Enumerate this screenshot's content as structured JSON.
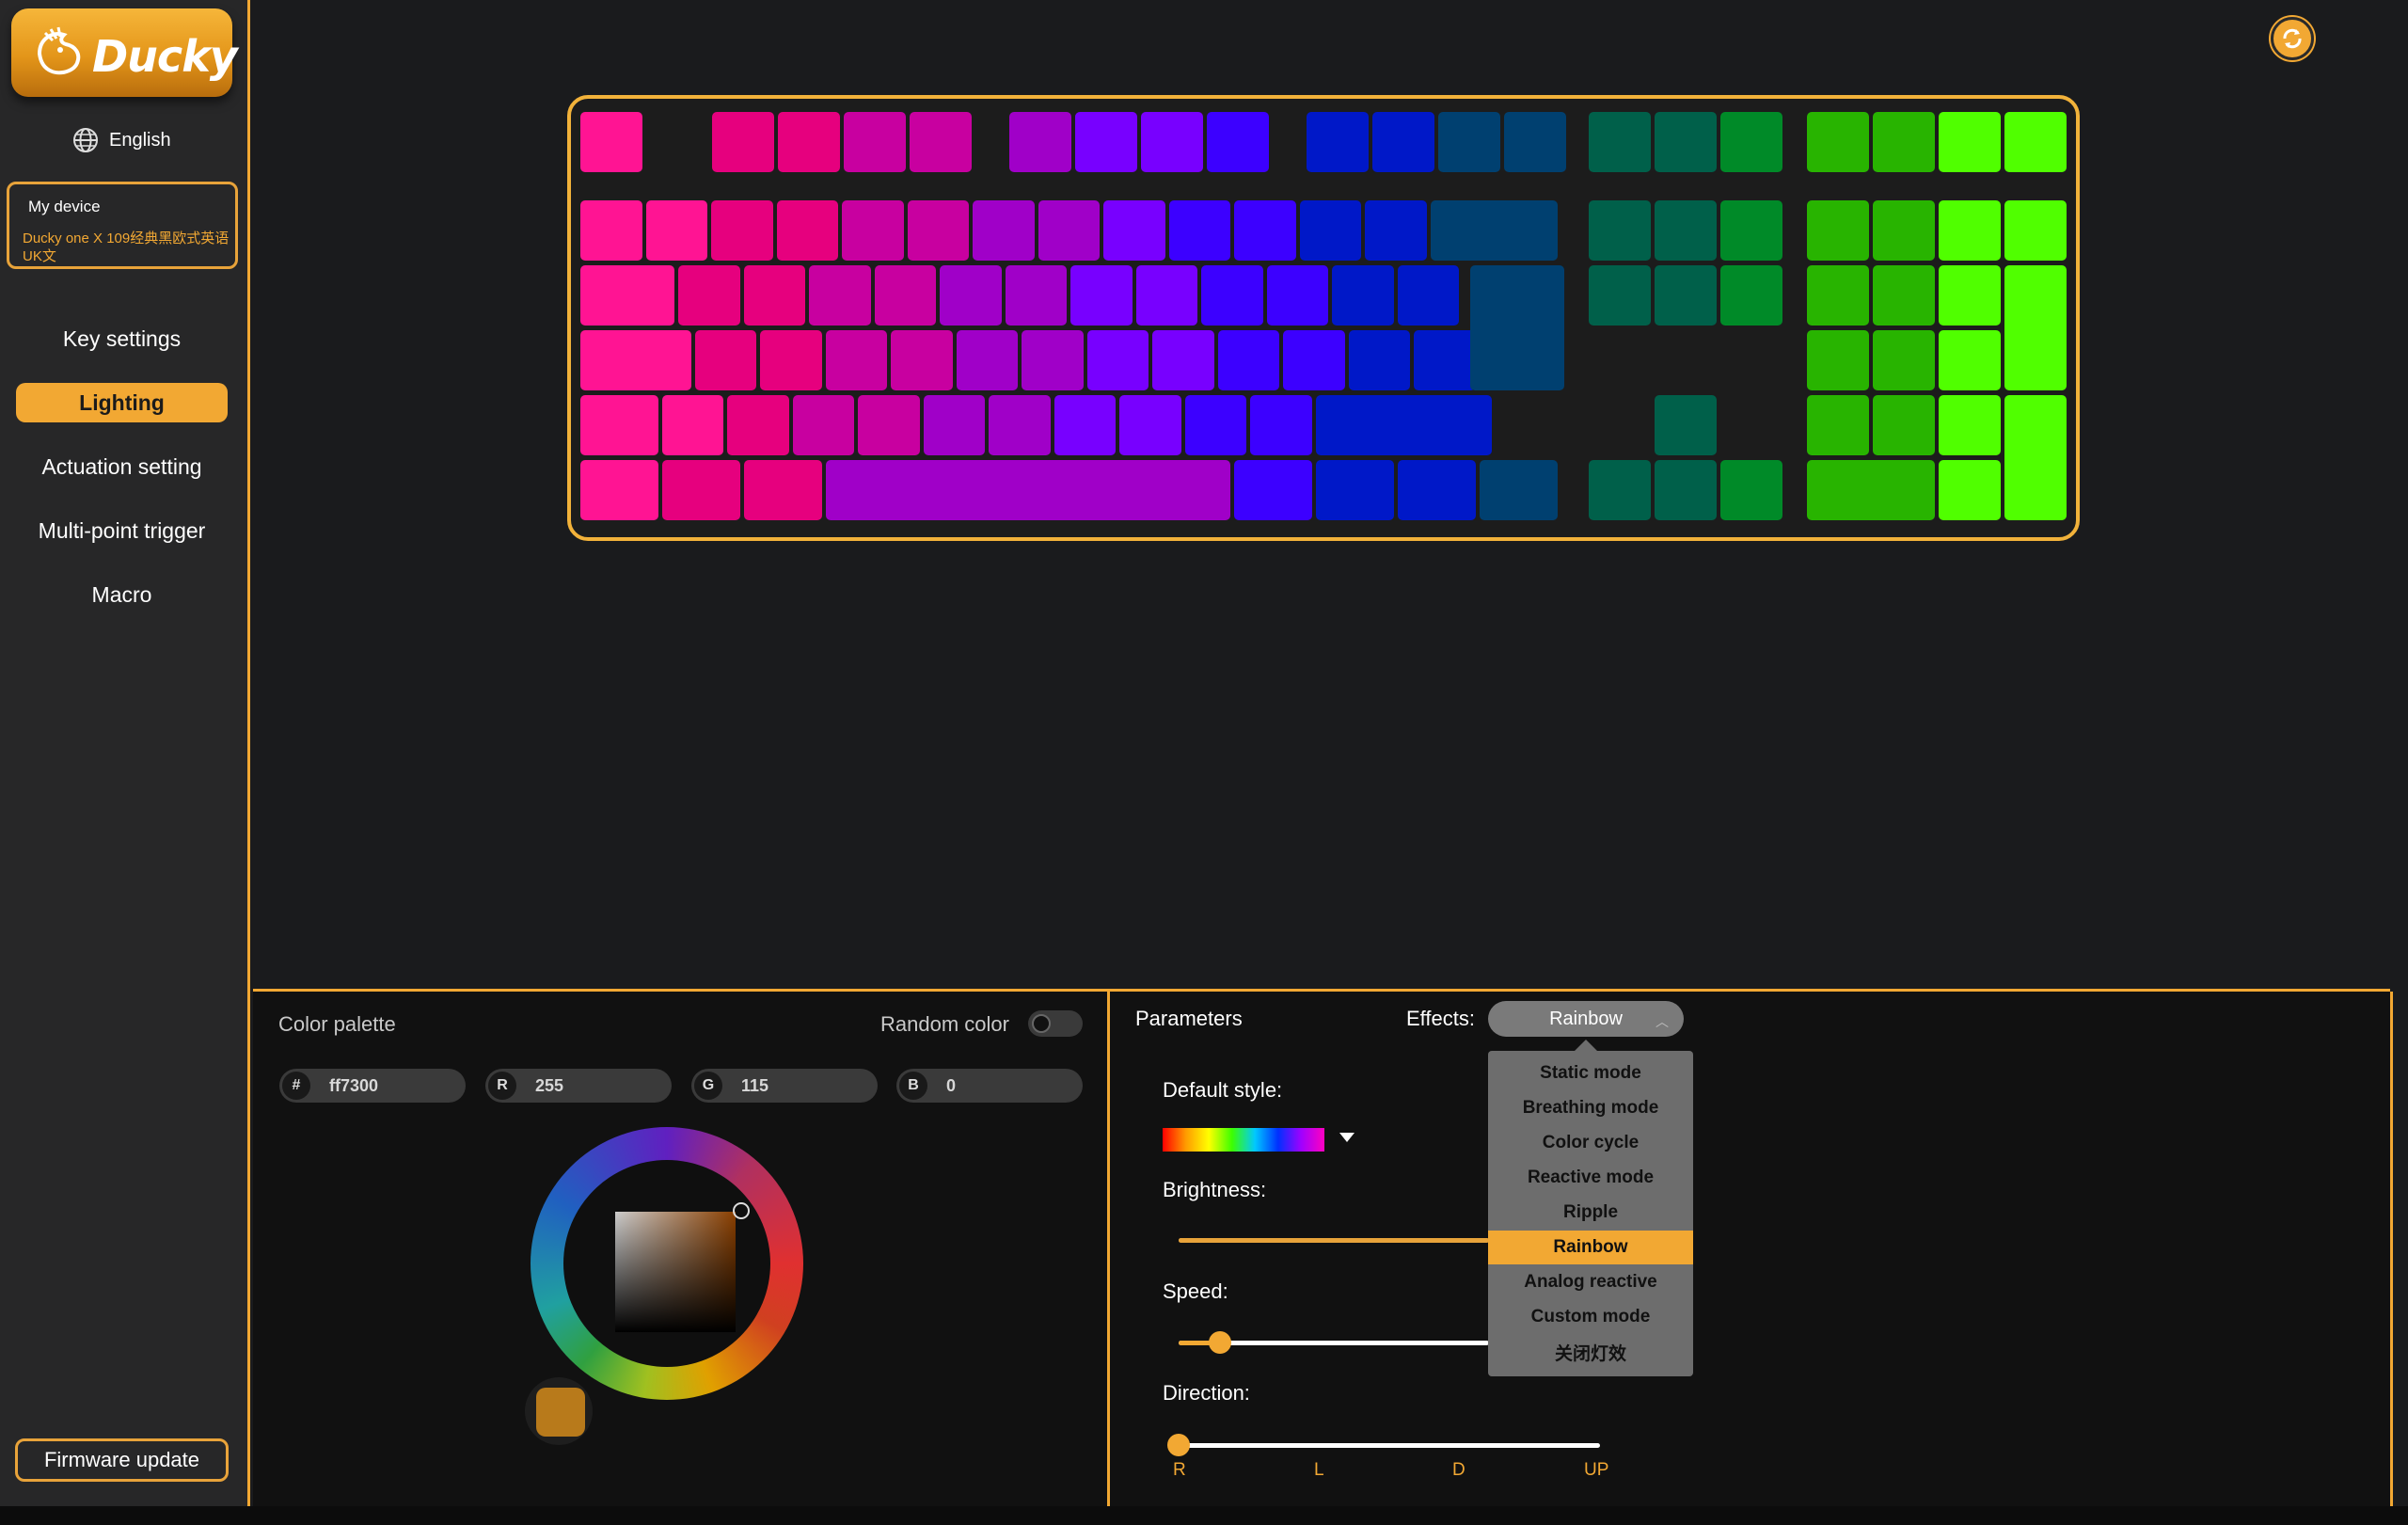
{
  "brand": {
    "logo_text": "Ducky",
    "accent": "#f2a833"
  },
  "sidebar": {
    "language": "English",
    "device": {
      "title": "My device",
      "name": "Ducky one X 109经典黑欧式英语UK文"
    },
    "nav": [
      {
        "label": "Key settings",
        "active": false
      },
      {
        "label": "Lighting",
        "active": true
      },
      {
        "label": "Actuation setting",
        "active": false
      },
      {
        "label": "Multi-point trigger",
        "active": false
      },
      {
        "label": "Macro",
        "active": false
      }
    ],
    "firmware_label": "Firmware update"
  },
  "toolbar": {
    "sync_icon": "refresh-icon"
  },
  "keyboard": {
    "effect_preview": "Rainbow",
    "key_colors": [
      "#ff1493",
      "#e6007e",
      "#c800a0",
      "#a000c8",
      "#7800ff",
      "#3c00ff",
      "#0018c8",
      "#004070",
      "#00604a",
      "#008a28",
      "#28b400",
      "#50ff00"
    ]
  },
  "palette": {
    "title": "Color palette",
    "random_label": "Random color",
    "random_enabled": false,
    "fields": [
      {
        "badge": "#",
        "value": "ff7300"
      },
      {
        "badge": "R",
        "value": "255"
      },
      {
        "badge": "G",
        "value": "115"
      },
      {
        "badge": "B",
        "value": "0"
      }
    ],
    "current_swatch": "#b87a1b"
  },
  "parameters": {
    "title": "Parameters",
    "effects_label": "Effects:",
    "effects_value": "Rainbow",
    "dropdown_options": [
      "Static mode",
      "Breathing mode",
      "Color cycle",
      "Reactive mode",
      "Ripple",
      "Rainbow",
      "Analog reactive",
      "Custom mode",
      "关闭灯效"
    ],
    "dropdown_selected": "Rainbow",
    "default_style_label": "Default style:",
    "brightness_label": "Brightness:",
    "brightness_level": 1.0,
    "speed_label": "Speed:",
    "speed_level": 0.1,
    "direction_label": "Direction:",
    "direction_options": [
      "R",
      "L",
      "D",
      "UP"
    ],
    "direction_selected": "R"
  }
}
